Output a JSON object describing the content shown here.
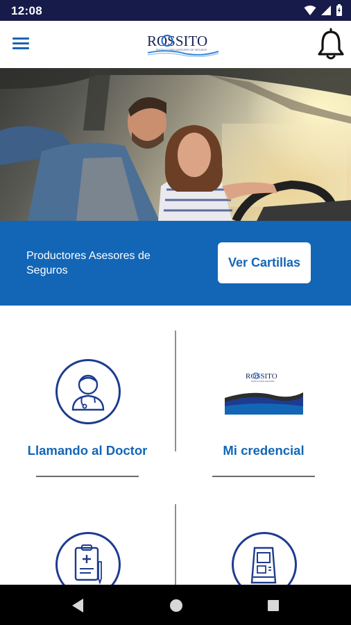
{
  "status_bar": {
    "time": "12:08"
  },
  "app_bar": {
    "logo_text": "ROSSITO",
    "logo_tagline": "PRODUCTORES ASESORES DE SEGUROS"
  },
  "banner": {
    "text": "Productores Asesores de Seguros",
    "button_label": "Ver Cartillas"
  },
  "tiles": [
    {
      "label": "Llamando al Doctor",
      "icon": "doctor-icon"
    },
    {
      "label": "Mi credencial",
      "icon": "credential-card-image"
    },
    {
      "label": "",
      "icon": "clipboard-medical-icon"
    },
    {
      "label": "",
      "icon": "atm-icon"
    }
  ],
  "colors": {
    "primary_blue": "#1366b6",
    "icon_navy": "#1d3b8f",
    "status_bar": "#171b4a"
  }
}
